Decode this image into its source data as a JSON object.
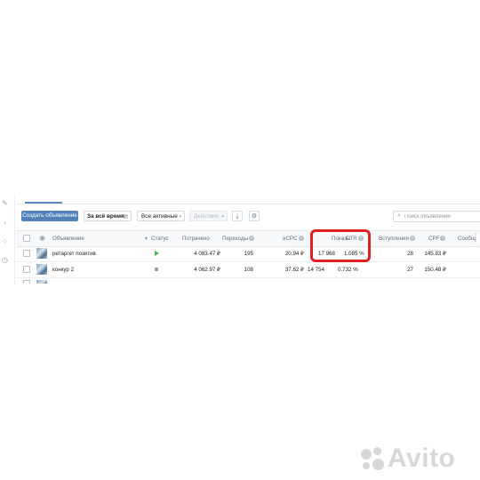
{
  "toolbar": {
    "create_label": "Создать объявление",
    "period_label": "За всё время",
    "filter_label": "Все активные",
    "action_label": "Действия",
    "search_placeholder": "Поиск объявлений"
  },
  "table": {
    "headers": {
      "ad": "Объявление",
      "status": "Статус",
      "spent": "Потрачено",
      "clicks": "Переходы",
      "ecpc": "eCPC",
      "impressions": "Показы",
      "ctr": "CTR",
      "joins": "Вступления",
      "cpf": "CPF",
      "messages": "Сообще"
    },
    "rows": [
      {
        "name": "ретаргет позитив",
        "status": "active",
        "spent": "4 083.47 ₽",
        "clicks": "195",
        "ecpc": "20.94 ₽",
        "impressions": "17 968",
        "ctr": "1.085 %",
        "joins": "28",
        "cpf": "145.83 ₽"
      },
      {
        "name": "конкур 2",
        "status": "paused",
        "spent": "4 062.97 ₽",
        "clicks": "108",
        "ecpc": "37.62 ₽",
        "impressions": "14 754",
        "ctr": "0.732 %",
        "joins": "27",
        "cpf": "150.48 ₽"
      }
    ]
  },
  "watermark": {
    "text": "Avito"
  },
  "colors": {
    "primary": "#5181b8",
    "link": "#2a5885",
    "highlight": "#e02020",
    "active": "#4bb34b"
  }
}
